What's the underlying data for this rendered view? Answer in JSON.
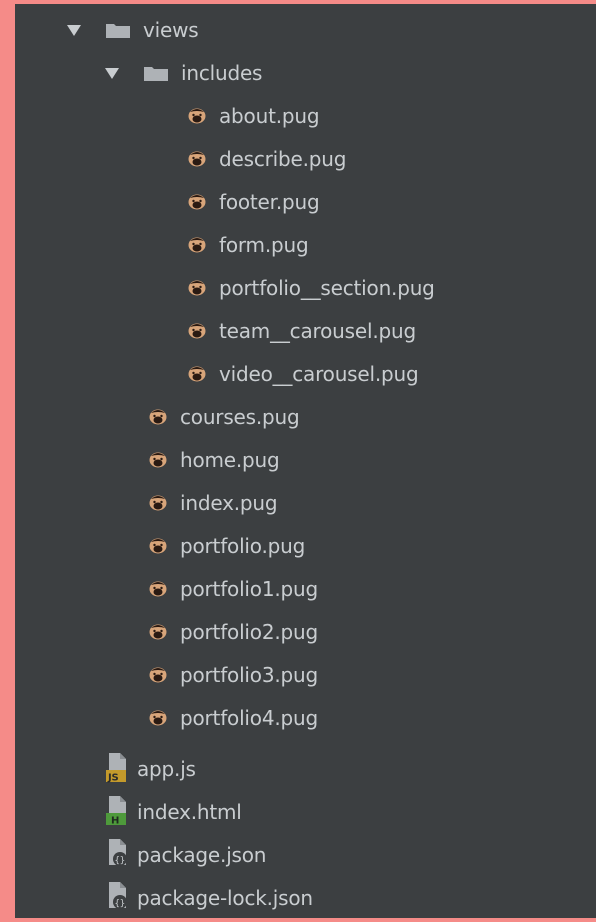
{
  "tree": {
    "views_folder": {
      "label": "views",
      "icon": "folder-icon",
      "expanded": true
    },
    "includes_folder": {
      "label": "includes",
      "icon": "folder-icon",
      "expanded": true
    },
    "include_files": [
      {
        "label": "about.pug",
        "icon": "pug-file-icon"
      },
      {
        "label": "describe.pug",
        "icon": "pug-file-icon"
      },
      {
        "label": "footer.pug",
        "icon": "pug-file-icon"
      },
      {
        "label": "form.pug",
        "icon": "pug-file-icon"
      },
      {
        "label": "portfolio__section.pug",
        "icon": "pug-file-icon"
      },
      {
        "label": "team__carousel.pug",
        "icon": "pug-file-icon"
      },
      {
        "label": "video__carousel.pug",
        "icon": "pug-file-icon"
      }
    ],
    "view_files": [
      {
        "label": "courses.pug",
        "icon": "pug-file-icon"
      },
      {
        "label": "home.pug",
        "icon": "pug-file-icon"
      },
      {
        "label": "index.pug",
        "icon": "pug-file-icon"
      },
      {
        "label": "portfolio.pug",
        "icon": "pug-file-icon"
      },
      {
        "label": "portfolio1.pug",
        "icon": "pug-file-icon"
      },
      {
        "label": "portfolio2.pug",
        "icon": "pug-file-icon"
      },
      {
        "label": "portfolio3.pug",
        "icon": "pug-file-icon"
      },
      {
        "label": "portfolio4.pug",
        "icon": "pug-file-icon"
      }
    ],
    "root_files": [
      {
        "label": "app.js",
        "icon": "js-file-icon",
        "badge": "JS",
        "badge_color": "#c49a2b"
      },
      {
        "label": "index.html",
        "icon": "html-file-icon",
        "badge": "H",
        "badge_color": "#4e9a3b"
      },
      {
        "label": "package.json",
        "icon": "json-file-icon",
        "badge": "{}"
      },
      {
        "label": "package-lock.json",
        "icon": "json-file-icon",
        "badge": "{}"
      }
    ]
  },
  "colors": {
    "background": "#f58b88",
    "panel": "#3c3f41",
    "text": "#c9cdd0",
    "folder": "#aeb2b6",
    "pug_face": "#d8a57a",
    "pug_dark": "#2a1a12"
  }
}
